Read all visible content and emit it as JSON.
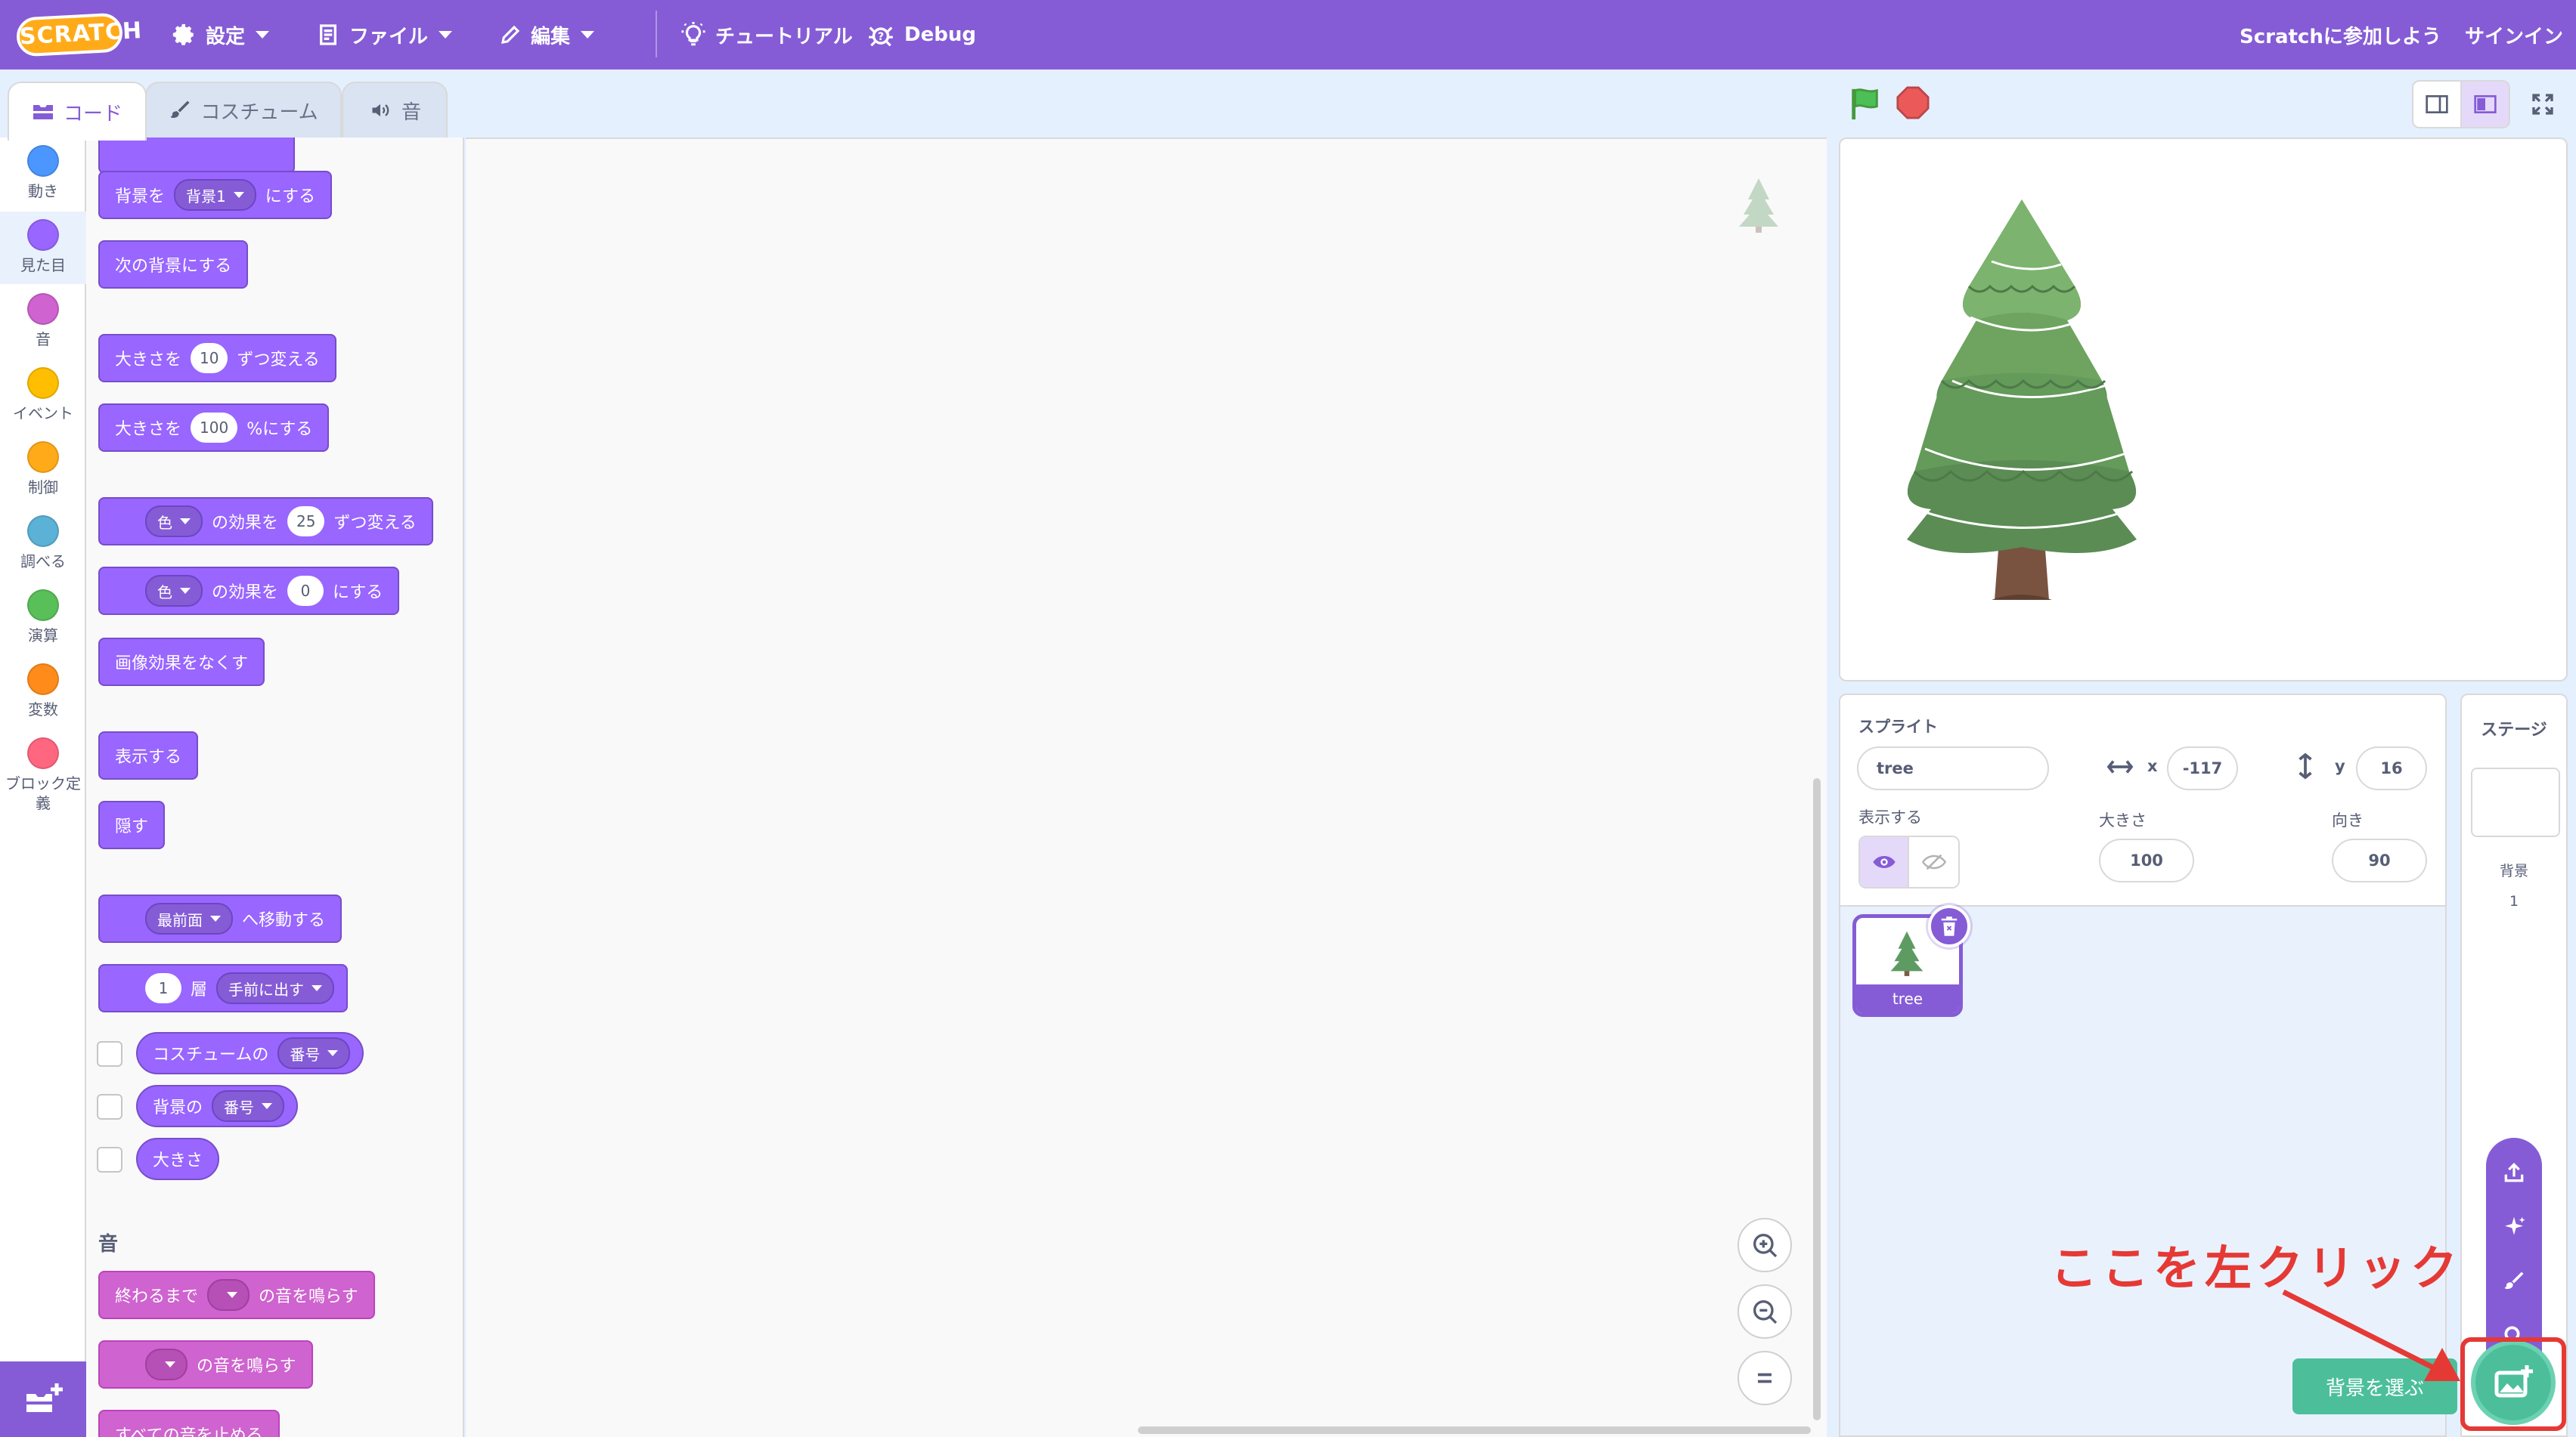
{
  "menu": {
    "logo": "SCRATCH",
    "settings": "設定",
    "file": "ファイル",
    "edit": "編集",
    "tutorials": "チュートリアル",
    "debug": "Debug",
    "join": "Scratchに参加しよう",
    "signin": "サインイン"
  },
  "tabs": {
    "code": "コード",
    "costumes": "コスチューム",
    "sounds": "音"
  },
  "categories": [
    {
      "label": "動き",
      "color": "#4c97ff"
    },
    {
      "label": "見た目",
      "color": "#9966ff"
    },
    {
      "label": "音",
      "color": "#cf63cf"
    },
    {
      "label": "イベント",
      "color": "#ffbf00"
    },
    {
      "label": "制御",
      "color": "#ffab19"
    },
    {
      "label": "調べる",
      "color": "#5cb1d6"
    },
    {
      "label": "演算",
      "color": "#59c059"
    },
    {
      "label": "変数",
      "color": "#ff8c1a"
    },
    {
      "label": "ブロック定義",
      "color": "#ff6680"
    }
  ],
  "blocks": {
    "switch_backdrop": {
      "pre": "背景を",
      "value": "背景1",
      "post": "にする"
    },
    "next_backdrop": "次の背景にする",
    "change_size": {
      "pre": "大きさを",
      "value": "10",
      "post": "ずつ変える"
    },
    "set_size": {
      "pre": "大きさを",
      "value": "100",
      "post": "%にする"
    },
    "change_effect": {
      "effect": "色",
      "mid": "の効果を",
      "value": "25",
      "post": "ずつ変える"
    },
    "set_effect": {
      "effect": "色",
      "mid": "の効果を",
      "value": "0",
      "post": "にする"
    },
    "clear_effects": "画像効果をなくす",
    "show": "表示する",
    "hide": "隠す",
    "go_to_layer": {
      "value": "最前面",
      "post": "へ移動する"
    },
    "go_layers": {
      "value": "1",
      "mid": "層",
      "dir": "手前に出す"
    },
    "costume_number": {
      "pre": "コスチュームの",
      "value": "番号"
    },
    "backdrop_number": {
      "pre": "背景の",
      "value": "番号"
    },
    "size_reporter": "大きさ",
    "sound_section": "音",
    "play_sound_until_done": {
      "pre": "終わるまで",
      "post": "の音を鳴らす"
    },
    "start_sound": {
      "post": "の音を鳴らす"
    },
    "stop_all_sounds": "すべての音を止める"
  },
  "sprite_info": {
    "sprite_label": "スプライト",
    "sprite_name": "tree",
    "x_label": "x",
    "x_value": "-117",
    "y_label": "y",
    "y_value": "16",
    "show_label": "表示する",
    "size_label": "大きさ",
    "size_value": "100",
    "direction_label": "向き",
    "direction_value": "90"
  },
  "sprite_card": {
    "name": "tree"
  },
  "stage_pane": {
    "title": "ステージ",
    "backdrops_label": "背景",
    "backdrops_count": "1"
  },
  "tooltip": "背景を選ぶ",
  "annotation": "ここを左クリック",
  "colors": {
    "accent": "#855cd6",
    "annotation": "#e53935",
    "backdrop_button": "#4cbf9a"
  }
}
